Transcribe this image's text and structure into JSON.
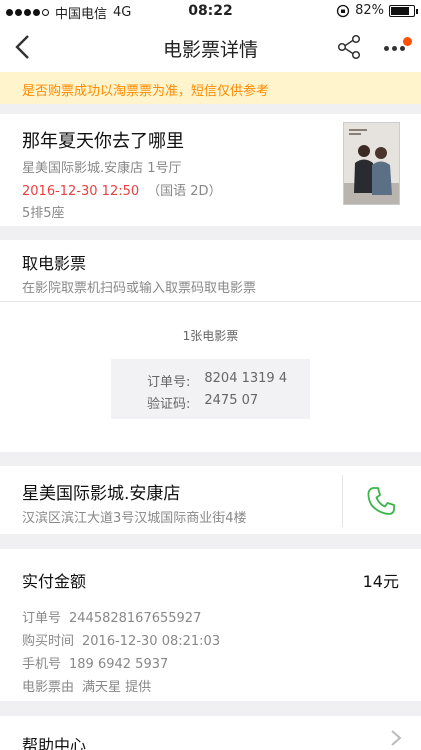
{
  "status_bar": {
    "carrier": "中国电信",
    "network": "4G",
    "time": "08:22",
    "battery": "82%",
    "battery_level": 0.82
  },
  "nav": {
    "title": "电影票详情"
  },
  "notice": "是否购票成功以淘票票为准，短信仅供参考",
  "movie": {
    "title": "那年夏天你去了哪里",
    "cinema_hall": "星美国际影城.安康店 1号厅",
    "showtime": "2016-12-30 12:50",
    "language": "（国语 2D）",
    "seat": "5排5座"
  },
  "pickup": {
    "heading": "取电影票",
    "instructions": "在影院取票机扫码或输入取票码取电影票",
    "ticket_count": "1张电影票",
    "order_label": "订单号:",
    "order_value": "8204 1319 4",
    "code_label": "验证码:",
    "code_value": "2475 07"
  },
  "store": {
    "name": "星美国际影城.安康店",
    "address": "汉滨区滨江大道3号汉城国际商业街4楼"
  },
  "payment": {
    "label": "实付金额",
    "amount": "14元",
    "details": [
      {
        "label": "订单号",
        "value": "2445828167655927"
      },
      {
        "label": "购买时间",
        "value": "2016-12-30 08:21:03"
      },
      {
        "label": "手机号",
        "value": "189 6942 5937"
      },
      {
        "label": "电影票由",
        "value": "满天星 提供"
      }
    ]
  },
  "help": {
    "label": "帮助中心"
  },
  "colors": {
    "notice_bg": "#fff4cc",
    "notice_text": "#ff8a00",
    "showtime": "#e84141",
    "phone_icon": "#3bb54a",
    "badge": "#ff5000"
  }
}
